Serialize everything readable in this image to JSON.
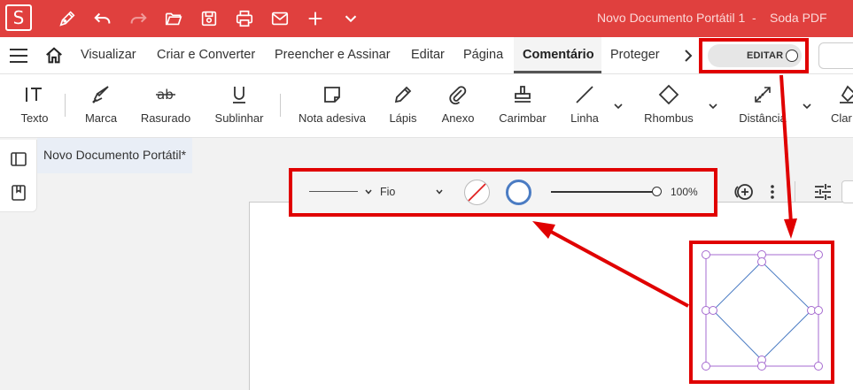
{
  "titlebar": {
    "logo_letter": "S",
    "document_title": "Novo Documento Portátil 1",
    "separator": "-",
    "app_name": "Soda PDF",
    "background": "#e0403e"
  },
  "menu": {
    "items": [
      "Visualizar",
      "Criar e Converter",
      "Preencher e Assinar",
      "Editar",
      "Página",
      "Comentário",
      "Proteger"
    ],
    "active": "Comentário",
    "edit_toggle_label": "EDITAR"
  },
  "ribbon": {
    "tools": [
      {
        "label": "Texto",
        "icon": "text-tool-icon"
      },
      {
        "label": "Marca",
        "icon": "highlighter-icon"
      },
      {
        "label": "Rasurado",
        "icon": "strikethrough-icon"
      },
      {
        "label": "Sublinhar",
        "icon": "underline-icon"
      },
      {
        "label": "Nota adesiva",
        "icon": "sticky-note-icon"
      },
      {
        "label": "Lápis",
        "icon": "pencil-icon"
      },
      {
        "label": "Anexo",
        "icon": "paperclip-icon"
      },
      {
        "label": "Carimbar",
        "icon": "stamp-icon"
      },
      {
        "label": "Linha",
        "icon": "line-icon"
      },
      {
        "label": "Rhombus",
        "icon": "rhombus-icon"
      },
      {
        "label": "Distância",
        "icon": "distance-icon"
      },
      {
        "label": "Clar",
        "icon": "eraser-icon"
      }
    ]
  },
  "document_tab": {
    "title": "Novo Documento Portátil*"
  },
  "properties": {
    "line_style": "Fio",
    "opacity": "100%",
    "opacity_value": 1.0,
    "stroke_color": "#4b7cc3",
    "fill": "none"
  },
  "annotation": {
    "shape": "rhombus",
    "stroke_color": "#4b7cc3",
    "selection_color": "#9b59b6",
    "highlight_color": "#e00000"
  }
}
